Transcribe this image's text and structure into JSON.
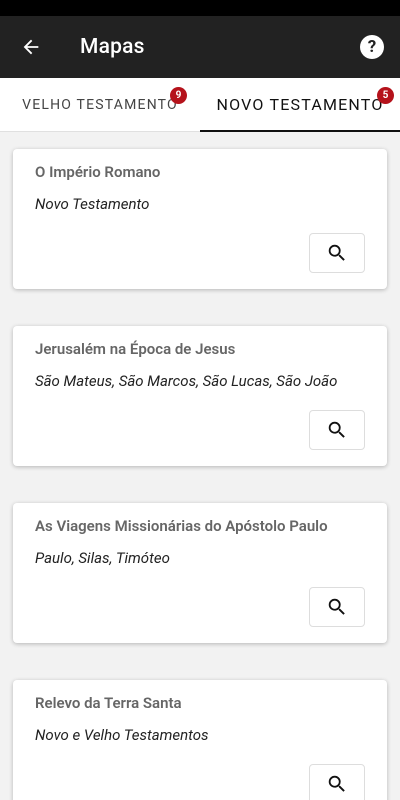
{
  "appbar": {
    "title": "Mapas"
  },
  "tabs": [
    {
      "label": "VELHO TESTAMENTO",
      "badge": "9",
      "active": false
    },
    {
      "label": "NOVO TESTAMENTO",
      "badge": "5",
      "active": true
    }
  ],
  "maps": [
    {
      "title": "O Império Romano",
      "subtitle": "Novo Testamento"
    },
    {
      "title": "Jerusalém na Época de Jesus",
      "subtitle": "São Mateus, São Marcos, São Lucas, São João"
    },
    {
      "title": "As Viagens Missionárias do Apóstolo Paulo",
      "subtitle": "Paulo, Silas, Timóteo"
    },
    {
      "title": "Relevo da Terra Santa",
      "subtitle": "Novo e Velho Testamentos"
    }
  ],
  "colors": {
    "appbar": "#222222",
    "badge": "#b5121b"
  }
}
